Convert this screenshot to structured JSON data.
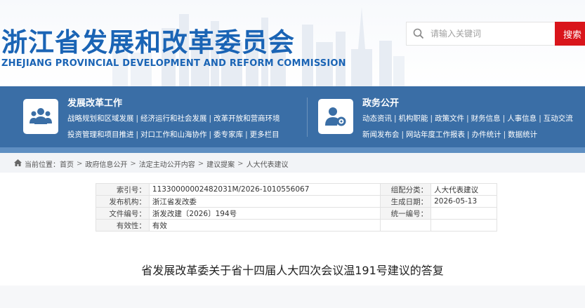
{
  "header": {
    "title": "浙江省发展和改革委员会",
    "subtitle": "ZHEJIANG PROVINCIAL DEVELOPMENT AND REFORM COMMISSION"
  },
  "search": {
    "placeholder": "请输入关键词",
    "button_label": "搜索"
  },
  "nav": {
    "left": {
      "heading": "发展改革工作",
      "icon": "people-icon",
      "row1": [
        "战略规划和区域发展",
        "经济运行和社会发展",
        "改革开放和营商环境"
      ],
      "row2": [
        "投资管理和项目推进",
        "对口工作和山海协作",
        "委专家库",
        "更多栏目"
      ]
    },
    "right": {
      "heading": "政务公开",
      "icon": "user-gear-icon",
      "row1": [
        "动态资讯",
        "机构职能",
        "政策文件",
        "财务信息",
        "人事信息",
        "互动交流"
      ],
      "row2": [
        "新闻发布会",
        "网站年度工作报表",
        "办件统计",
        "数据统计"
      ]
    }
  },
  "breadcrumb": {
    "label": "当前位置：",
    "items": [
      "首页",
      "政府信息公开",
      "法定主动公开内容",
      "建议提案",
      "人大代表建议"
    ]
  },
  "meta": {
    "rows": [
      {
        "k1": "索引号：",
        "v1": "11330000002482031M/2026-1010556067",
        "k2": "组配分类：",
        "v2": "人大代表建议"
      },
      {
        "k1": "发布机构：",
        "v1": "浙江省发改委",
        "k2": "生成日期：",
        "v2": "2026-05-13"
      },
      {
        "k1": "文件编号：",
        "v1": "浙发改建〔2026〕194号",
        "k2": "统一编号：",
        "v2": ""
      },
      {
        "k1": "有效性：",
        "v1": "有效"
      }
    ]
  },
  "doc_title": "省发展改革委关于省十四届人大四次会议温191号建议的答复",
  "colors": {
    "brand_blue": "#1a64b5",
    "nav_blue": "#3a6ea6",
    "search_red": "#d9151b"
  }
}
